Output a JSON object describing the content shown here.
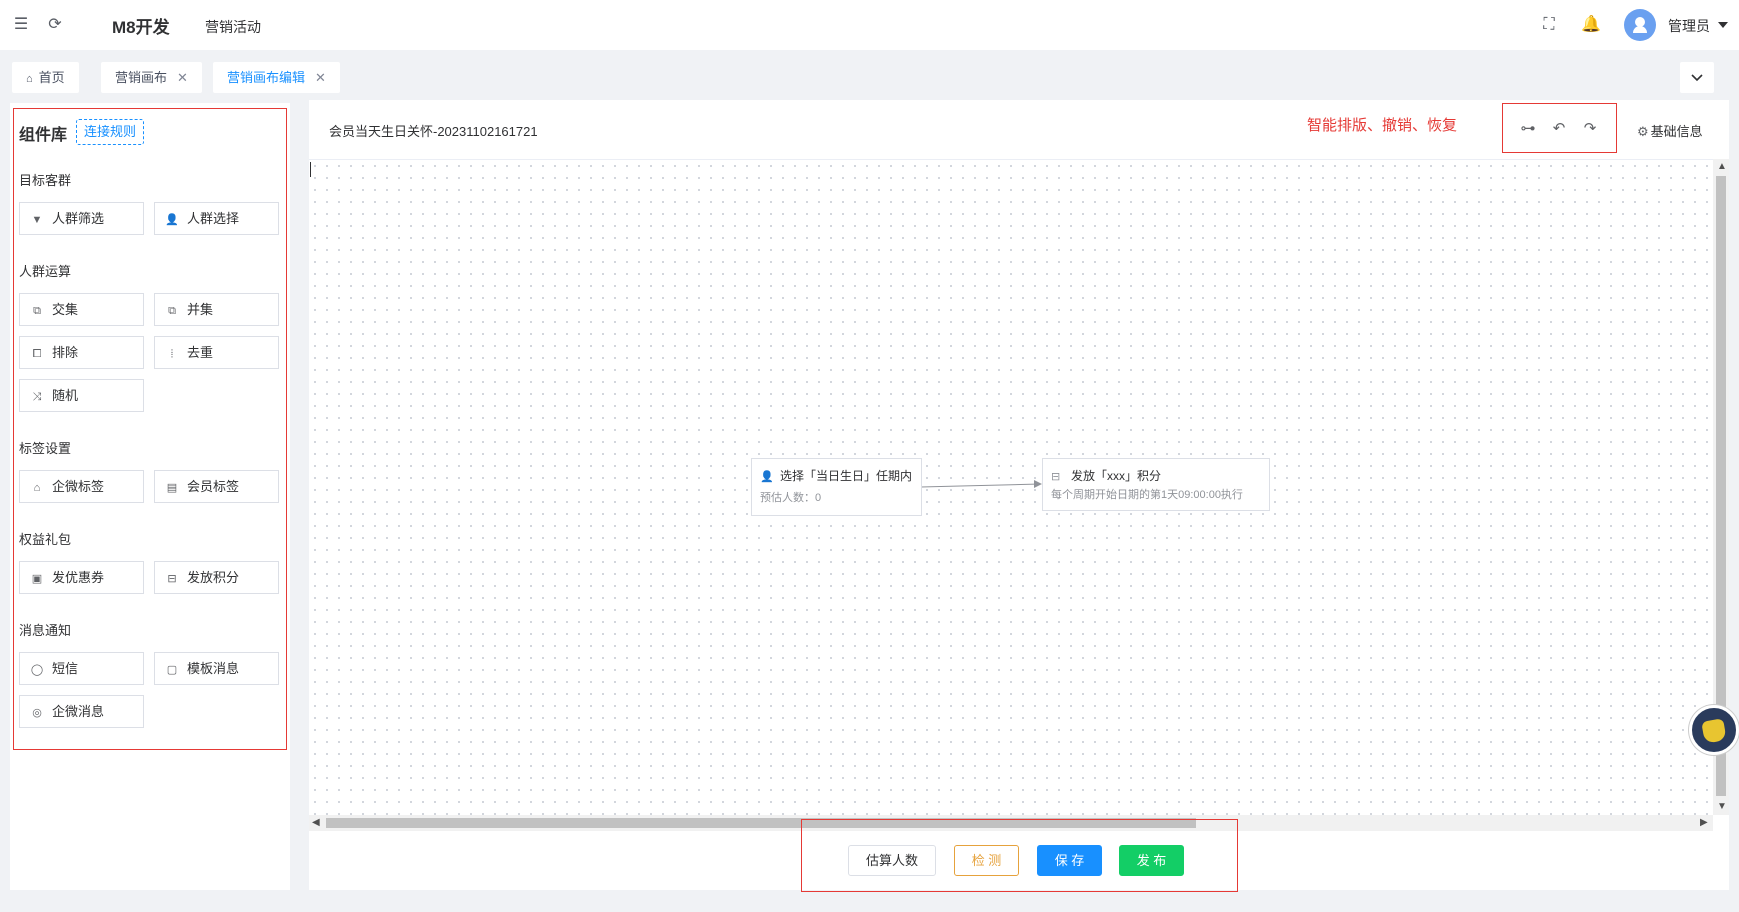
{
  "header": {
    "app_title": "M8开发",
    "breadcrumb": "营销活动",
    "user_name": "管理员"
  },
  "tabs": [
    {
      "label": "首页"
    },
    {
      "label": "营销画布"
    },
    {
      "label": "营销画布编辑"
    }
  ],
  "library": {
    "title": "组件库",
    "rules_link": "连接规则",
    "sections": [
      {
        "title": "目标客群",
        "items": [
          "人群筛选",
          "人群选择"
        ]
      },
      {
        "title": "人群运算",
        "items": [
          "交集",
          "并集",
          "排除",
          "去重",
          "随机"
        ]
      },
      {
        "title": "标签设置",
        "items": [
          "企微标签",
          "会员标签"
        ]
      },
      {
        "title": "权益礼包",
        "items": [
          "发优惠券",
          "发放积分"
        ]
      },
      {
        "title": "消息通知",
        "items": [
          "短信",
          "模板消息",
          "企微消息"
        ]
      }
    ]
  },
  "canvas": {
    "title": "会员当天生日关怀-20231102161721",
    "annotation": "智能排版、撤销、恢复",
    "base_info": "基础信息",
    "nodes": [
      {
        "title": "选择「当日生日」任期内",
        "subtitle": "预估人数：0",
        "icon": "user-icon"
      },
      {
        "title": "发放「xxx」积分",
        "subtitle": "每个周期开始日期的第1天09:00:00执行",
        "icon": "points-icon"
      }
    ]
  },
  "footer": {
    "estimate": "估算人数",
    "check": "检 测",
    "save": "保 存",
    "publish": "发 布"
  },
  "colors": {
    "primary": "#1890ff",
    "warning": "#e6a23c",
    "success": "#13ce66",
    "annotation_red": "#e53935"
  }
}
